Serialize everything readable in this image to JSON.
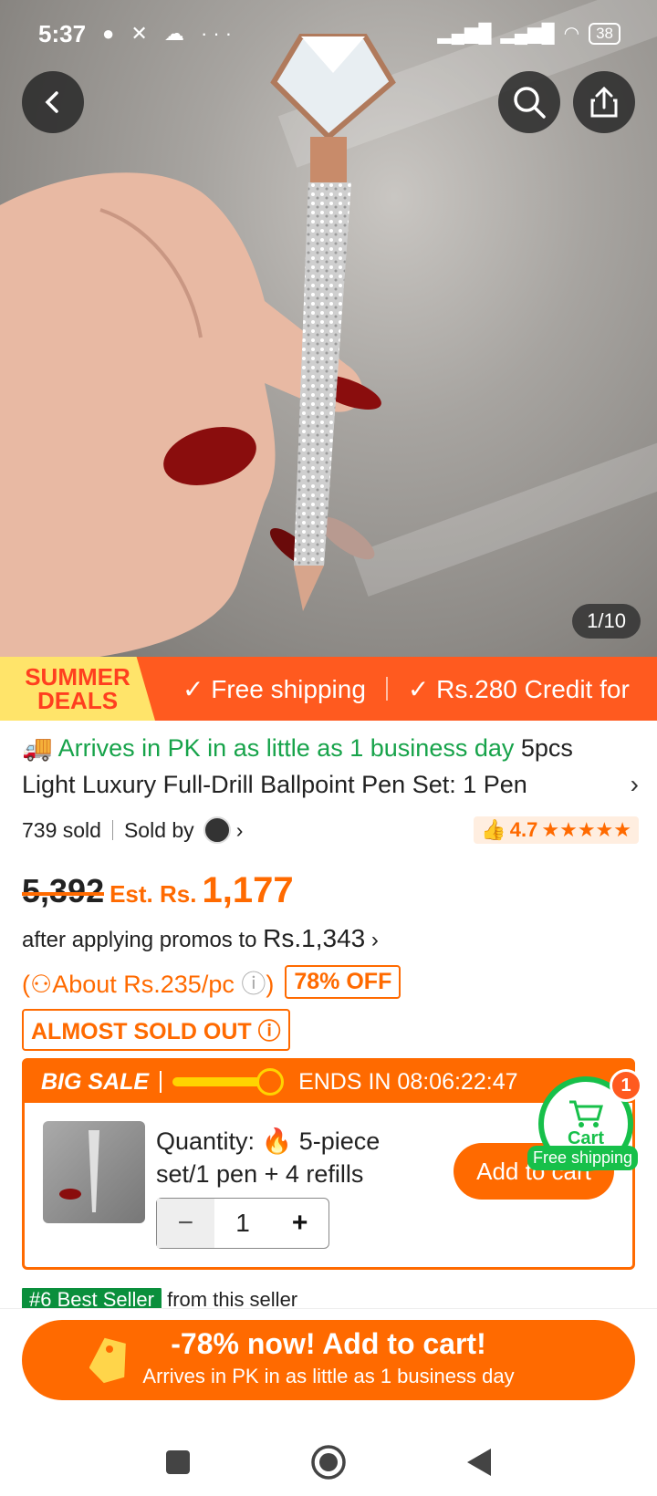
{
  "status_bar": {
    "time": "5:37",
    "battery": "38"
  },
  "hero": {
    "image_counter": "1/10"
  },
  "promo_banner": {
    "badge_line1": "SUMMER",
    "badge_line2": "DEALS",
    "item1": "✓ Free shipping",
    "item2": "✓ Rs.280 Credit for"
  },
  "product": {
    "arrival": "Arrives in PK in as little as 1 business day",
    "title": "5pcs Light Luxury Full-Drill Ballpoint Pen Set: 1 Pen",
    "sold": "739 sold",
    "sold_by": "Sold by",
    "rating": "4.7",
    "old_price": "5,392",
    "est_label": "Est. Rs.",
    "price": "1,177",
    "promo_text": "after applying promos to",
    "promo_price": "Rs.1,343",
    "about": "About Rs.235/pc",
    "off": "78% OFF",
    "almost_sold": "ALMOST SOLD OUT"
  },
  "big_sale": {
    "label": "BIG SALE",
    "ends": "ENDS IN 08:06:22:47",
    "quantity_label": "Quantity:",
    "quantity_value": "5-piece set/1 pen + 4 refills",
    "qty": "1",
    "add_to_cart": "Add to cart"
  },
  "cart_float": {
    "label": "Cart",
    "count": "1",
    "shipping": "Free shipping"
  },
  "best_seller": {
    "tag": "#6 Best Seller",
    "text": "from this seller"
  },
  "cta": {
    "line1": "-78% now! Add to cart!",
    "line2": "Arrives in PK in as little as 1 business day"
  },
  "colors": {
    "accent": "#ff6a00",
    "green": "#17a34a"
  }
}
